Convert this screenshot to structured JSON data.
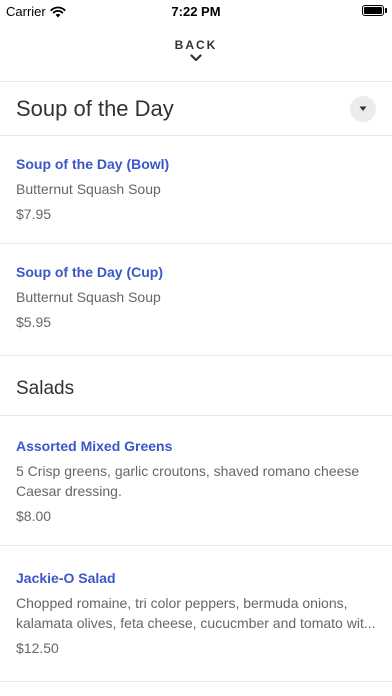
{
  "status": {
    "carrier": "Carrier",
    "time": "7:22 PM",
    "battery_level": 1.0
  },
  "nav": {
    "back_label": "BACK"
  },
  "sections": [
    {
      "title": "Soup of the Day",
      "items": [
        {
          "name": "Soup of the Day (Bowl)",
          "description": "Butternut Squash Soup",
          "price": "$7.95"
        },
        {
          "name": "Soup of the Day (Cup)",
          "description": "Butternut Squash Soup",
          "price": "$5.95"
        }
      ]
    },
    {
      "title": "Salads",
      "items": [
        {
          "name": "Assorted Mixed Greens",
          "description_lines": [
            "5 Crisp greens, garlic croutons, shaved romano cheese",
            "Caesar dressing."
          ],
          "price": "$8.00"
        },
        {
          "name": "Jackie-O Salad",
          "description_lines": [
            "Chopped romaine, tri color peppers, bermuda onions,",
            "kalamata olives, feta cheese, cucucmber and tomato wit..."
          ],
          "price": "$12.50"
        }
      ]
    }
  ],
  "colors": {
    "item_name": "#3b56c9",
    "divider": "#e6e6e6",
    "text_secondary": "#666666"
  }
}
